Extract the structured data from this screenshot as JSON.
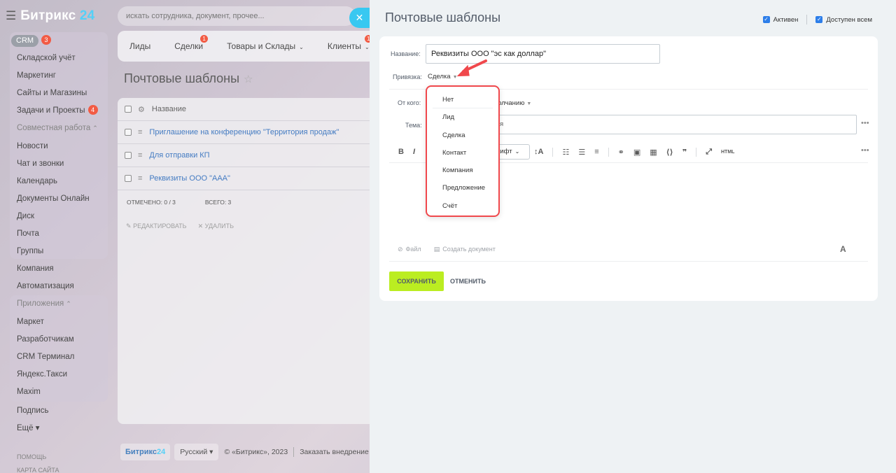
{
  "sidebar": {
    "brand_name": "Битрикс",
    "brand_num": "24",
    "crm_label": "CRM",
    "crm_badge": "3",
    "items": [
      {
        "label": "Складской учёт"
      },
      {
        "label": "Маркетинг"
      },
      {
        "label": "Сайты и Магазины"
      },
      {
        "label": "Задачи и Проекты",
        "badge": "4"
      },
      {
        "label": "Совместная работа"
      },
      {
        "label": "Новости"
      },
      {
        "label": "Чат и звонки"
      },
      {
        "label": "Календарь"
      },
      {
        "label": "Документы Онлайн"
      },
      {
        "label": "Диск"
      },
      {
        "label": "Почта"
      },
      {
        "label": "Группы"
      },
      {
        "label": "Компания"
      },
      {
        "label": "Автоматизация"
      },
      {
        "label": "Приложения"
      },
      {
        "label": "Маркет"
      },
      {
        "label": "Разработчикам"
      },
      {
        "label": "CRM Терминал"
      },
      {
        "label": "Яндекс.Такси"
      },
      {
        "label": "Maxim"
      },
      {
        "label": "Подпись"
      },
      {
        "label": "Ещё"
      }
    ],
    "help": "ПОМОЩЬ",
    "sitemap": "КАРТА САЙТА"
  },
  "search": {
    "placeholder": "искать сотрудника, документ, прочее..."
  },
  "crm_tabs": [
    {
      "label": "Лиды"
    },
    {
      "label": "Сделки",
      "badge": "1"
    },
    {
      "label": "Товары и Склады"
    },
    {
      "label": "Клиенты",
      "badge": "1"
    }
  ],
  "bg_page": {
    "title": "Почтовые шаблоны",
    "col_name": "Название",
    "rows": [
      {
        "name": "Приглашение на конференцию \"Территория продаж\""
      },
      {
        "name": "Для отправки КП"
      },
      {
        "name": "Реквизиты ООО \"ААА\""
      }
    ],
    "selected": "ОТМЕЧЕНО: 0 / 3",
    "total": "ВСЕГО: 3",
    "edit": "РЕДАКТИРОВАТЬ",
    "delete": "УДАЛИТЬ"
  },
  "footer": {
    "brand": "Битрикс",
    "brand_num": "24",
    "lang": "Русский",
    "copyright": "© «Битрикс», 2023",
    "order": "Заказать внедрение"
  },
  "slider": {
    "title": "Почтовые шаблоны",
    "active_label": "Активен",
    "available_label": "Доступен всем",
    "name_label": "Название:",
    "name_value": "Реквизиты ООО \"эс как доллар\"",
    "bind_label": "Привязка:",
    "bind_value": "Сделка",
    "from_label": "От кого:",
    "from_value": "олчанию",
    "subject_label": "Тема:",
    "subject_value": "я",
    "font_label": "рифт",
    "file_label": "Файл",
    "create_doc_label": "Создать документ",
    "save_label": "СОХРАНИТЬ",
    "cancel_label": "ОТМЕНИТЬ"
  },
  "dropdown": {
    "items": [
      "Нет",
      "Лид",
      "Сделка",
      "Контакт",
      "Компания",
      "Предложение",
      "Счёт"
    ]
  },
  "colors": {
    "accent_blue": "#2fc6f6",
    "save_green": "#bbed21",
    "highlight_red": "#f0484c",
    "badge_red": "#f0371b"
  }
}
